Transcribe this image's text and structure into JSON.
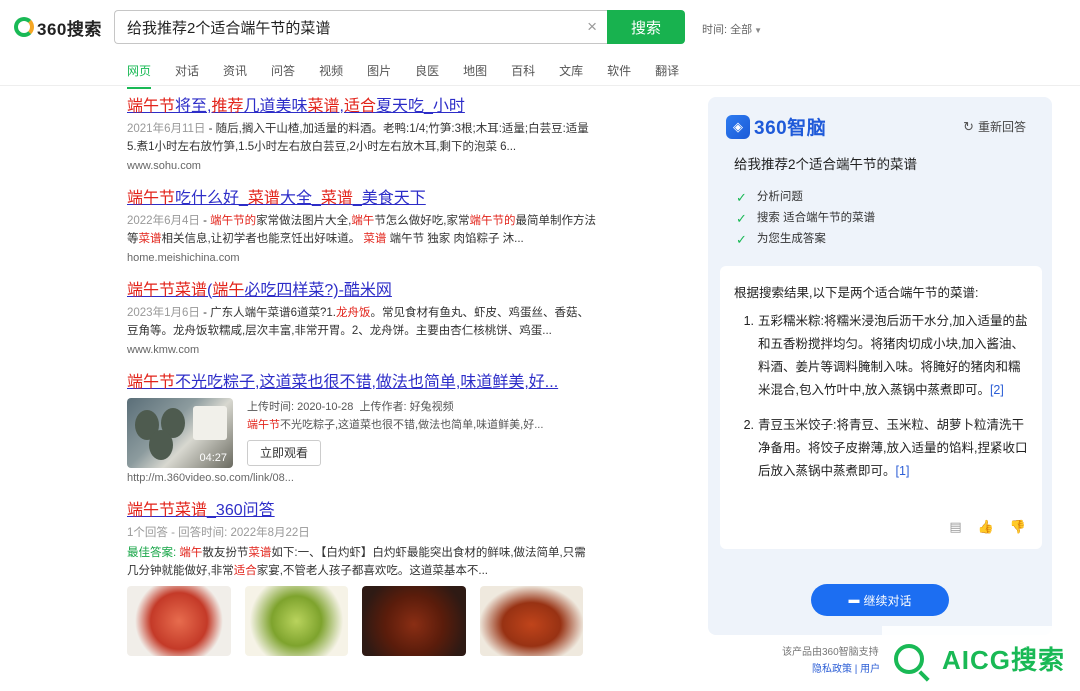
{
  "brand": {
    "logo_text": "360搜索"
  },
  "search": {
    "query": "给我推荐2个适合端午节的菜谱",
    "button_label": "搜索"
  },
  "time_filter": "时间: 全部",
  "nav": [
    "网页",
    "对话",
    "资讯",
    "问答",
    "视频",
    "图片",
    "良医",
    "地图",
    "百科",
    "文库",
    "软件",
    "翻译"
  ],
  "results": [
    {
      "title_parts": [
        [
          "端午节",
          true
        ],
        [
          "将至,",
          false
        ],
        [
          "推荐",
          true
        ],
        [
          "几道美味",
          false
        ],
        [
          "菜谱",
          true
        ],
        [
          ",",
          false
        ],
        [
          "适合",
          true
        ],
        [
          "夏天吃_小时",
          false
        ]
      ],
      "date": "2021年6月11日",
      "desc": " - 随后,搁入干山楂,加适量的料酒。老鸭:1/4;竹笋:3根;木耳:适量;白芸豆:适量 5.煮1小时左右放竹笋,1.5小时左右放白芸豆,2小时左右放木耳,剩下的泡菜 6...",
      "url": "www.sohu.com"
    },
    {
      "title_parts": [
        [
          "端午节",
          true
        ],
        [
          "吃什么好_",
          false
        ],
        [
          "菜谱",
          true
        ],
        [
          "大全_",
          false
        ],
        [
          "菜谱",
          true
        ],
        [
          "_美食天下",
          false
        ]
      ],
      "date": "2022年6月4日",
      "desc_parts": [
        [
          " - ",
          "n"
        ],
        [
          "端午节的",
          "r"
        ],
        [
          "家常做法图片大全,",
          "n"
        ],
        [
          "端午",
          "r"
        ],
        [
          "节怎么做好吃,家常",
          "n"
        ],
        [
          "端午节的",
          "r"
        ],
        [
          "最简单制作方法等",
          "n"
        ],
        [
          "菜谱",
          "r"
        ],
        [
          "相关信息,让初学者也能烹饪出好味道。 ",
          "n"
        ],
        [
          "菜谱",
          "r"
        ],
        [
          " 端午节 独家 肉馅粽子 沐...",
          "n"
        ]
      ],
      "url": "home.meishichina.com"
    },
    {
      "title_parts": [
        [
          "端午节菜谱",
          true
        ],
        [
          "(",
          false
        ],
        [
          "端午",
          true
        ],
        [
          "必吃四样菜?)-酷米网",
          false
        ]
      ],
      "date": "2023年1月6日",
      "desc_parts": [
        [
          " - 广东人端午菜谱6道菜?1.",
          "n"
        ],
        [
          "龙舟饭",
          "r"
        ],
        [
          "。常见食材有鱼丸、虾皮、鸡蛋丝、香菇、豆角等。龙舟饭软糯咸,层次丰富,非常开胃。2、龙舟饼。主要由杏仁核桃饼、鸡蛋...",
          "n"
        ]
      ],
      "url": "www.kmw.com"
    }
  ],
  "video_result": {
    "title_parts": [
      [
        "端午节",
        true
      ],
      [
        "不光吃粽子,这道菜也很不错,做法也简单,味道鲜美,好...",
        false
      ]
    ],
    "upload_time": "上传时间: 2020-10-28",
    "uploader": "上传作者: 好兔视频",
    "desc_hl": "端午节",
    "desc": "不光吃粽子,这道菜也很不错,做法也简单,味道鲜美,好...",
    "duration": "04:27",
    "watch_label": "立即观看",
    "url": "http://m.360video.so.com/link/08..."
  },
  "qa_result": {
    "title_parts": [
      [
        "端午节菜谱",
        true
      ],
      [
        "_360问答",
        false
      ]
    ],
    "meta": "1个回答 - 回答时间: 2022年8月22日",
    "desc_parts": [
      [
        "最佳答案:",
        "g"
      ],
      [
        " ",
        "n"
      ],
      [
        "端午",
        "r"
      ],
      [
        "散友扮节",
        "n"
      ],
      [
        "菜谱",
        "r"
      ],
      [
        "如下:一、【白灼虾】白灼虾最能突出食材的鲜味,做法简单,只需几分钟就能做好,非常",
        "n"
      ],
      [
        "适合",
        "r"
      ],
      [
        "家宴,不管老人孩子都喜欢吃。这道菜基本不...",
        "n"
      ]
    ]
  },
  "ai": {
    "logo_text": "360智脑",
    "reanswer_label": "重新回答",
    "query": "给我推荐2个适合端午节的菜谱",
    "steps": [
      "分析问题",
      "搜索 适合端午节的菜谱",
      "为您生成答案"
    ],
    "intro": "根据搜索结果,以下是两个适合端午节的菜谱:",
    "answers": [
      {
        "num": "1.",
        "text": "五彩糯米粽:将糯米浸泡后沥干水分,加入适量的盐和五香粉搅拌均匀。将猪肉切成小块,加入酱油、料酒、姜片等调料腌制入味。将腌好的猪肉和糯米混合,包入竹叶中,放入蒸锅中蒸煮即可。",
        "cite": "[2]"
      },
      {
        "num": "2.",
        "text": "青豆玉米饺子:将青豆、玉米粒、胡萝卜粒清洗干净备用。将饺子皮擀薄,放入适量的馅料,捏紧收口后放入蒸锅中蒸煮即可。",
        "cite": "[1]"
      }
    ],
    "continue_label": "继续对话",
    "disclaimer": "该产品由360智脑支持",
    "footer": "隐私政策 | 用户"
  },
  "watermark_brand": "AICG搜索",
  "colors": {
    "accent_green": "#19b955",
    "link_blue": "#2d2dc8",
    "highlight_red": "#e2231a",
    "ai_blue": "#1c6ef2"
  }
}
